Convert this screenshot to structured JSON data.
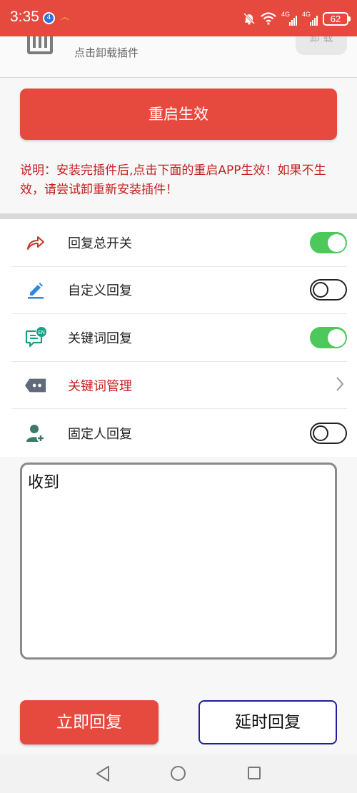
{
  "status_bar": {
    "time": "3:35",
    "notification_icons": [
      "app-badge-icon",
      "app-s-icon"
    ],
    "signal_1_label": "4G",
    "signal_2_label": "4G",
    "battery": "62"
  },
  "uninstall": {
    "hint": "点击卸载插件",
    "button_label": "卸 载"
  },
  "restart_button": "重启生效",
  "notice": "说明：安装完插件后,点击下面的重启APP生效！如果不生效，请尝试卸重新安装插件！",
  "settings": [
    {
      "icon": "share-arrow-icon",
      "label": "回复总开关",
      "control": "toggle",
      "on": true
    },
    {
      "icon": "pencil-icon",
      "label": "自定义回复",
      "control": "toggle",
      "on": false
    },
    {
      "icon": "chat-en-icon",
      "label": "关键词回复",
      "control": "toggle",
      "on": true
    },
    {
      "icon": "message-tag-icon",
      "label": "关键词管理",
      "control": "chevron"
    },
    {
      "icon": "person-add-icon",
      "label": "固定人回复",
      "control": "toggle",
      "on": false
    }
  ],
  "reply_text": "收到",
  "buttons": {
    "reply_now": "立即回复",
    "delay_reply": "延时回复"
  },
  "colors": {
    "accent": "#e64a3f",
    "toggle_on": "#4cc95a",
    "notice_text": "#c41f1f"
  }
}
